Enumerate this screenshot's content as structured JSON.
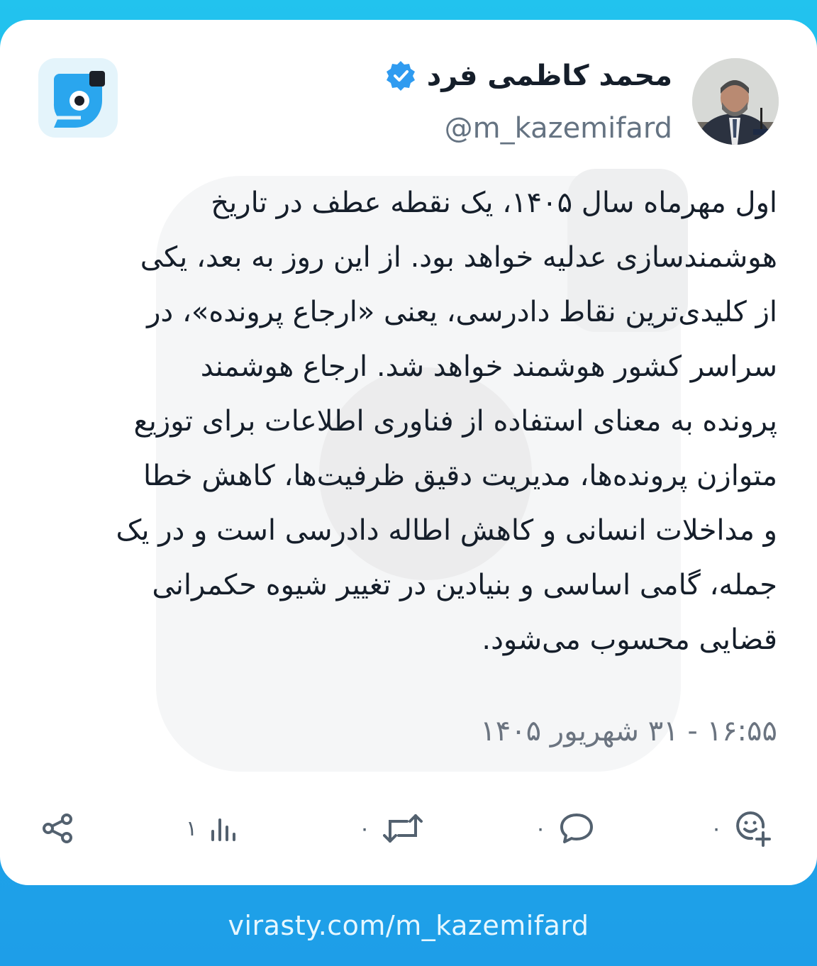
{
  "author": {
    "name": "محمد کاظمی فرد",
    "handle": "@m_kazemifard",
    "verified": true
  },
  "post": {
    "text": "اول مهرماه سال ۱۴۰۵، یک نقطه عطف در تاریخ\nهوشمندسازی عدلیه خواهد بود. از این روز به بعد، یکی\nاز کلیدی‌ترین نقاط دادرسی، یعنی «ارجاع پرونده»، در\nسراسر کشور هوشمند خواهد شد. ارجاع هوشمند\nپرونده به معنای استفاده از فناوری اطلاعات برای توزیع\nمتوازن پرونده‌ها، مدیریت دقیق ظرفیت‌ها، کاهش خطا\nو مداخلات انسانی و کاهش اطاله دادرسی است و در یک\nجمله، گامی اساسی و بنیادین در تغییر شیوه حکمرانی\nقضایی محسوب می‌شود.",
    "timestamp": "۱۶:۵۵ - ۳۱ شهریور ۱۴۰۵"
  },
  "actions": {
    "share_icon": "share-icon",
    "views_count": "۱",
    "reposts_count": "۰",
    "replies_count": "۰",
    "reactions_count": "۰"
  },
  "footer": {
    "url": "virasty.com/m_kazemifard"
  },
  "colors": {
    "accent": "#1da1f2",
    "footer_bg": "#1e9ee8",
    "verified": "#2f9bf0"
  }
}
